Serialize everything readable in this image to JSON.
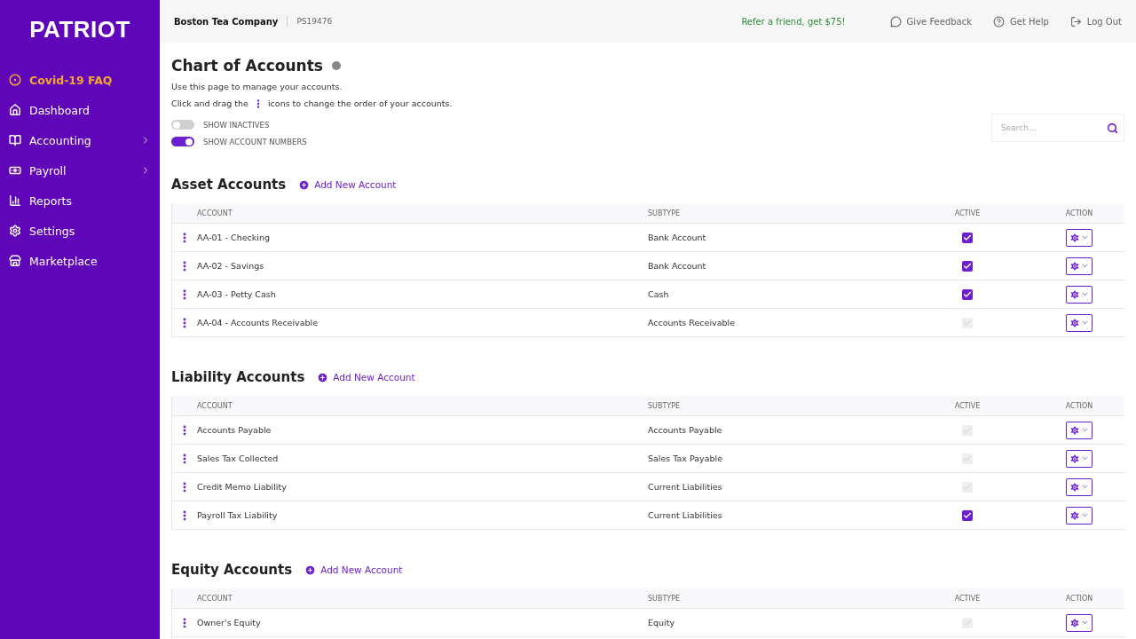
{
  "sidebar": {
    "logo": "PATRIOT",
    "items": [
      {
        "label": "Covid-19 FAQ",
        "kind": "faq",
        "color": "#f7a531",
        "submenu": false
      },
      {
        "label": "Dashboard",
        "kind": "home",
        "color": "#ffffff",
        "submenu": false
      },
      {
        "label": "Accounting",
        "kind": "book",
        "color": "#ffffff",
        "submenu": true
      },
      {
        "label": "Payroll",
        "kind": "money",
        "color": "#ffffff",
        "submenu": true
      },
      {
        "label": "Reports",
        "kind": "chart",
        "color": "#ffffff",
        "submenu": false
      },
      {
        "label": "Settings",
        "kind": "gear",
        "color": "#ffffff",
        "submenu": false
      },
      {
        "label": "Marketplace",
        "kind": "store",
        "color": "#ffffff",
        "submenu": false
      }
    ]
  },
  "topbar": {
    "company": "Boston Tea Company",
    "company_id": "PS19476",
    "refer": "Refer a friend, get $75!",
    "links": [
      {
        "label": "Give Feedback",
        "kind": "feedback"
      },
      {
        "label": "Get Help",
        "kind": "help"
      },
      {
        "label": "Log Out",
        "kind": "logout"
      }
    ]
  },
  "page": {
    "title": "Chart of Accounts",
    "intro": "Use this page to manage your accounts.",
    "drag_before": "Click and drag the",
    "drag_after": "icons to change the order of your accounts.",
    "toggles": [
      {
        "label": "SHOW INACTIVES",
        "on": false
      },
      {
        "label": "SHOW ACCOUNT NUMBERS",
        "on": true
      }
    ],
    "search": {
      "placeholder": "Search..."
    }
  },
  "sections": [
    {
      "title": "Asset Accounts",
      "add_label": "Add New Account",
      "columns": [
        "ACCOUNT",
        "SUBTYPE",
        "ACTIVE",
        "ACTION"
      ],
      "rows": [
        {
          "account": "AA-01 - Checking",
          "subtype": "Bank Account",
          "active": true
        },
        {
          "account": "AA-02 - Savings",
          "subtype": "Bank Account",
          "active": true
        },
        {
          "account": "AA-03 - Petty Cash",
          "subtype": "Cash",
          "active": true
        },
        {
          "account": "AA-04 - Accounts Receivable",
          "subtype": "Accounts Receivable",
          "active": false
        }
      ]
    },
    {
      "title": "Liability Accounts",
      "add_label": "Add New Account",
      "columns": [
        "ACCOUNT",
        "SUBTYPE",
        "ACTIVE",
        "ACTION"
      ],
      "rows": [
        {
          "account": "Accounts Payable",
          "subtype": "Accounts Payable",
          "active": false
        },
        {
          "account": "Sales Tax Collected",
          "subtype": "Sales Tax Payable",
          "active": false
        },
        {
          "account": "Credit Memo Liability",
          "subtype": "Current Liabilities",
          "active": false
        },
        {
          "account": "Payroll Tax Liability",
          "subtype": "Current Liabilities",
          "active": true
        }
      ]
    },
    {
      "title": "Equity Accounts",
      "add_label": "Add New Account",
      "columns": [
        "ACCOUNT",
        "SUBTYPE",
        "ACTIVE",
        "ACTION"
      ],
      "rows": [
        {
          "account": "Owner's Equity",
          "subtype": "Equity",
          "active": false
        }
      ]
    }
  ]
}
